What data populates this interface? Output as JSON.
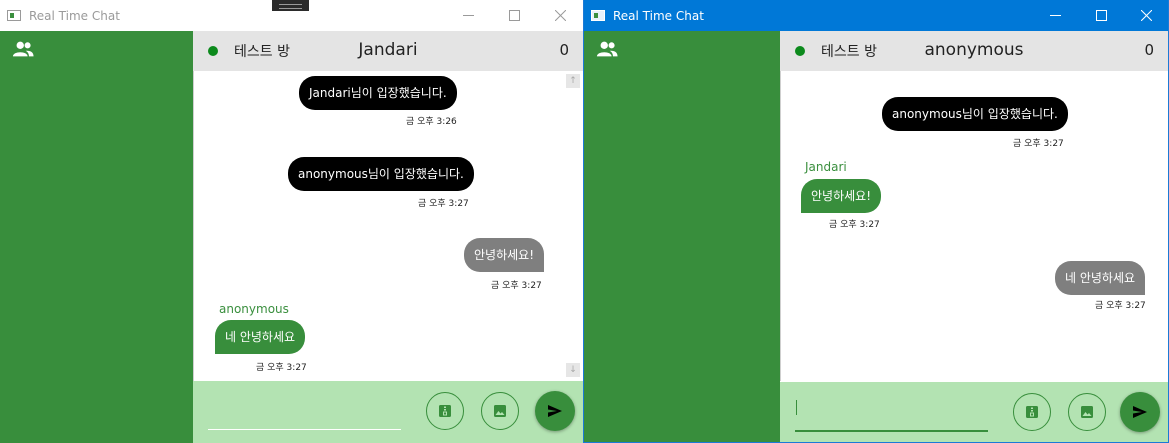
{
  "windows": [
    {
      "title": "Real Time Chat",
      "room_name": "테스트 방",
      "user_name": "Jandari",
      "count": "0",
      "messages": [
        {
          "type": "system",
          "text": "Jandari님이 입장했습니다.",
          "time": "금 오후 3:26"
        },
        {
          "type": "system",
          "text": "anonymous님이 입장했습니다.",
          "time": "금 오후 3:27"
        },
        {
          "type": "mine",
          "text": "안녕하세요!",
          "time": "금 오후 3:27"
        },
        {
          "type": "other",
          "sender": "anonymous",
          "text": "네 안녕하세요",
          "time": "금 오후 3:27"
        }
      ],
      "input": {
        "value": "",
        "placeholder": ""
      }
    },
    {
      "title": "Real Time Chat",
      "room_name": "테스트 방",
      "user_name": "anonymous",
      "count": "0",
      "messages": [
        {
          "type": "system",
          "text": "anonymous님이 입장했습니다.",
          "time": "금 오후 3:27"
        },
        {
          "type": "other",
          "sender": "Jandari",
          "text": "안녕하세요!",
          "time": "금 오후 3:27"
        },
        {
          "type": "mine",
          "text": "네 안녕하세요",
          "time": "금 오후 3:27"
        }
      ],
      "input": {
        "value": "",
        "placeholder": ""
      }
    }
  ],
  "icons": {
    "sidebar": "users-icon",
    "status": "online-dot-icon",
    "file_button": "zip-file-icon",
    "image_button": "image-icon",
    "send_button": "send-icon",
    "scroll_up": "arrow-up-icon",
    "scroll_down": "arrow-down-icon",
    "minimize": "minimize-icon",
    "maximize": "maximize-icon",
    "close": "close-icon"
  },
  "colors": {
    "sidebar": "#388e3c",
    "input_bar": "#b3e3b2",
    "header": "#e4e4e4",
    "system_bubble": "#000000",
    "my_bubble": "#7f7f7f",
    "other_bubble": "#388e3c",
    "online": "#0c8a1c",
    "active_titlebar": "#0078d7"
  }
}
